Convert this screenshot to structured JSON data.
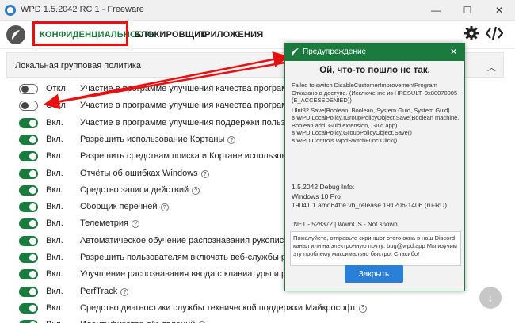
{
  "window": {
    "title": "WPD 1.5.2042 RC 1 - Freeware"
  },
  "tabs": [
    {
      "label": "КОНФИДЕНЦИАЛЬНОСТЬ"
    },
    {
      "label": "БЛОКИРОВЩИК"
    },
    {
      "label": "ПРИЛОЖЕНИЯ"
    }
  ],
  "section": {
    "title": "Локальная групповая политика"
  },
  "rows": [
    {
      "state": "Откл.",
      "on": false,
      "label": "Участие в программе улучшения качества программного обе",
      "help": false
    },
    {
      "state": "Откл.",
      "on": false,
      "label": "Участие в программе улучшения качества программного обе",
      "help": false
    },
    {
      "state": "Вкл.",
      "on": true,
      "label": "Участие в программе улучшения поддержки пользователей V",
      "help": false
    },
    {
      "state": "Вкл.",
      "on": true,
      "label": "Разрешить использование Кортаны",
      "help": true
    },
    {
      "state": "Вкл.",
      "on": true,
      "label": "Разрешить средствам поиска и Кортане использовать инфор",
      "help": false
    },
    {
      "state": "Вкл.",
      "on": true,
      "label": "Отчёты об ошибках Windows",
      "help": true
    },
    {
      "state": "Вкл.",
      "on": true,
      "label": "Средство записи действий",
      "help": true
    },
    {
      "state": "Вкл.",
      "on": true,
      "label": "Сборщик перечней",
      "help": true
    },
    {
      "state": "Вкл.",
      "on": true,
      "label": "Телеметрия",
      "help": true
    },
    {
      "state": "Вкл.",
      "on": true,
      "label": "Автоматическое обучение распознавания рукописного текст",
      "help": false
    },
    {
      "state": "Вкл.",
      "on": true,
      "label": "Разрешить пользователям включать веб-службы распознава",
      "help": false
    },
    {
      "state": "Вкл.",
      "on": true,
      "label": "Улучшение распознавания ввода с клавиатуры и рукописн",
      "help": false
    },
    {
      "state": "Вкл.",
      "on": true,
      "label": "PerfTrack",
      "help": true
    },
    {
      "state": "Вкл.",
      "on": true,
      "label": "Средство диагностики службы технической поддержки Майкрософт",
      "help": true
    },
    {
      "state": "Вкл.",
      "on": true,
      "label": "Идентификатор объявлений",
      "help": true
    }
  ],
  "dialog": {
    "title": "Предупреждение",
    "heading": "Ой, что-то пошло не так.",
    "error_lines": [
      "Failed to switch DisableCustomerImprovementProgram",
      "Отказано в доступе. (Исключение из HRESULT: 0x80070005",
      "(E_ACCESSDENIED))",
      "UInt32 Save(Boolean, Boolean, System.Guid, System.Guid)",
      "   в WPD.LocalPolicy.IGroupPolicyObject.Save(Boolean machine,",
      "Boolean add, Guid extension, Guid app)",
      "   в WPD.LocalPolicy.GroupPolicyObject.Save()",
      "   в WPD.Controls.WpdSwitchFunc.Click()"
    ],
    "debug_lines": [
      "1.5.2042 Debug Info:",
      "Windows 10 Pro",
      "19041.1.amd64fre.vb_release.191206-1406 (ru-RU)"
    ],
    "net_line": ".NET - 528372 | WarnOS - Not shown",
    "note": "Пожалуйста, отправьте скриншот этого окна в наш Discord канал или на электронную почту: bug@wpd.app Мы изучим эту проблему максимально быстро. Спасибо!",
    "button": "Закрыть"
  },
  "colors": {
    "accent": "#1b7a3e",
    "highlight": "#e81010",
    "button": "#2a7fd8"
  }
}
